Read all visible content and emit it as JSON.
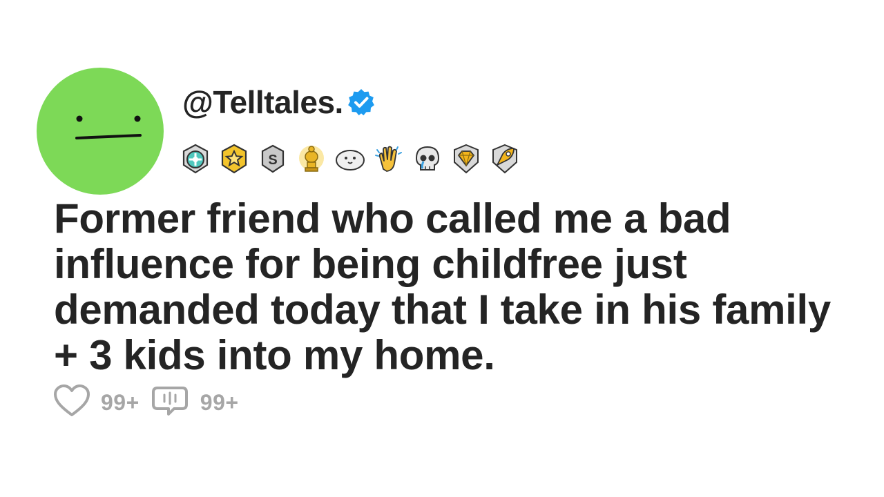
{
  "post": {
    "username": "@Telltales.",
    "title": "Former friend who called me a bad influence for being childfree just demanded today that I take in his family + 3 kids into my home.",
    "likes": "99+",
    "comments": "99+"
  },
  "awards": [
    "helpful-award-icon",
    "gold-star-award-icon",
    "silver-award-icon",
    "gold-trophy-award-icon",
    "seal-award-icon",
    "clapping-hands-award-icon",
    "crying-skull-award-icon",
    "gold-diamond-award-icon",
    "rocket-award-icon"
  ],
  "colors": {
    "avatar": "#7dd957",
    "verified": "#1d9bf0",
    "text": "#242424",
    "muted": "#a6a6a6"
  }
}
